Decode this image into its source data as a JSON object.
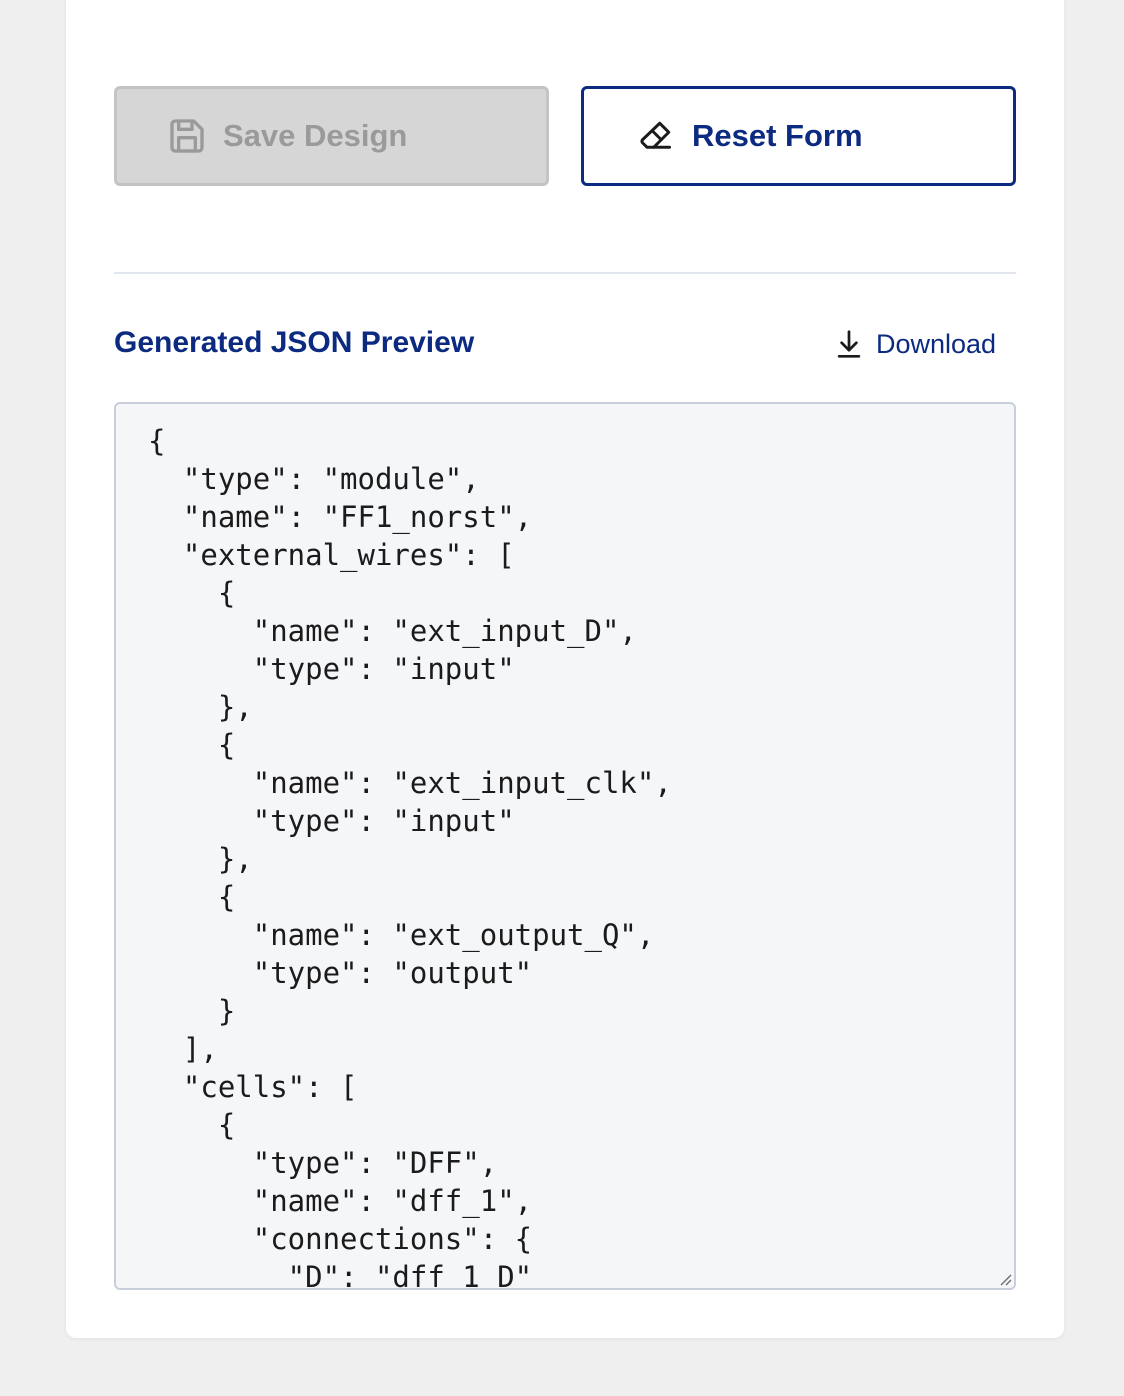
{
  "actions": {
    "save_label": "Save Design",
    "reset_label": "Reset Form"
  },
  "preview": {
    "title": "Generated JSON Preview",
    "download_label": "Download",
    "json_text": "{\n  \"type\": \"module\",\n  \"name\": \"FF1_norst\",\n  \"external_wires\": [\n    {\n      \"name\": \"ext_input_D\",\n      \"type\": \"input\"\n    },\n    {\n      \"name\": \"ext_input_clk\",\n      \"type\": \"input\"\n    },\n    {\n      \"name\": \"ext_output_Q\",\n      \"type\": \"output\"\n    }\n  ],\n  \"cells\": [\n    {\n      \"type\": \"DFF\",\n      \"name\": \"dff_1\",\n      \"connections\": {\n        \"D\": \"dff_1_D\""
  },
  "icons": {
    "save": "floppy-disk-icon",
    "reset": "eraser-icon",
    "download": "download-icon"
  },
  "colors": {
    "accent": "#0c2b80",
    "disabled_bg": "#d6d6d6",
    "disabled_text": "#9a9a9a",
    "code_bg": "#f5f6f8",
    "page_bg": "#efefef"
  }
}
